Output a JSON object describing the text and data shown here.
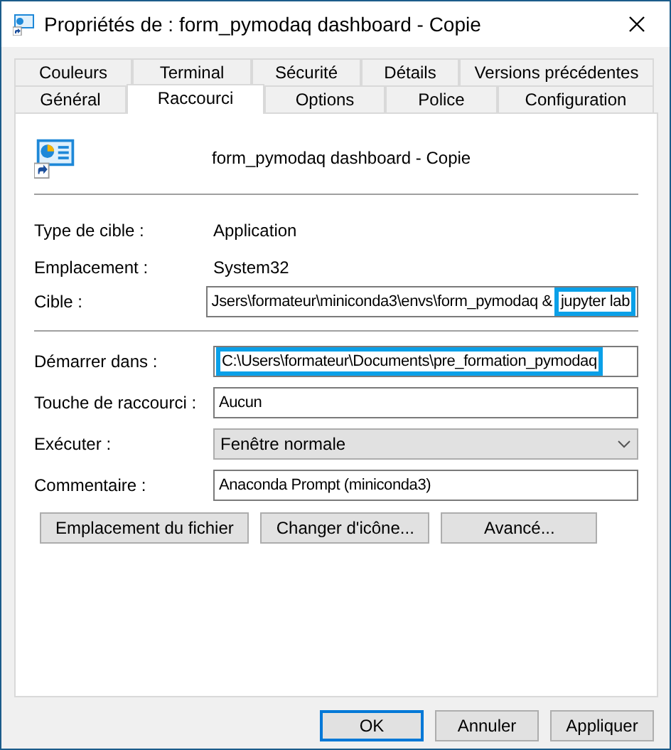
{
  "window": {
    "title": "Propriétés de : form_pymodaq dashboard - Copie"
  },
  "tab_rows": [
    [
      {
        "label": "Couleurs",
        "selected": false
      },
      {
        "label": "Terminal",
        "selected": false
      },
      {
        "label": "Sécurité",
        "selected": false
      },
      {
        "label": "Détails",
        "selected": false
      },
      {
        "label": "Versions précédentes",
        "selected": false
      }
    ],
    [
      {
        "label": "Général",
        "selected": false
      },
      {
        "label": "Raccourci",
        "selected": true
      },
      {
        "label": "Options",
        "selected": false
      },
      {
        "label": "Police",
        "selected": false
      },
      {
        "label": "Configuration",
        "selected": false
      }
    ]
  ],
  "shortcut_name": "form_pymodaq dashboard - Copie",
  "info": [
    {
      "label": "Type de cible :",
      "value": "Application"
    },
    {
      "label": "Emplacement :",
      "value": "System32"
    }
  ],
  "field_groups": [
    [
      {
        "kind": "input",
        "label": "Cible :",
        "segments": [
          {
            "text": "Jsers\\formateur\\miniconda3\\envs\\form_pymodaq &",
            "highlighted": false
          },
          {
            "text": "jupyter lab",
            "highlighted": true
          }
        ]
      }
    ],
    [
      {
        "kind": "input",
        "label": "Démarrer dans :",
        "segments": [
          {
            "text": "C:\\Users\\formateur\\Documents\\pre_formation_pymodaq",
            "highlighted": true
          }
        ]
      },
      {
        "kind": "input",
        "label": "Touche de raccourci :",
        "segments": [
          {
            "text": "Aucun",
            "highlighted": false
          }
        ]
      },
      {
        "kind": "select",
        "label": "Exécuter :",
        "value": "Fenêtre normale"
      },
      {
        "kind": "input",
        "label": "Commentaire :",
        "segments": [
          {
            "text": "Anaconda Prompt (miniconda3)",
            "highlighted": false
          }
        ]
      }
    ]
  ],
  "panel_buttons": [
    "Emplacement du fichier",
    "Changer d'icône...",
    "Avancé..."
  ],
  "dialog_buttons": [
    {
      "label": "OK",
      "default": true
    },
    {
      "label": "Annuler",
      "default": false
    },
    {
      "label": "Appliquer",
      "default": false
    }
  ]
}
